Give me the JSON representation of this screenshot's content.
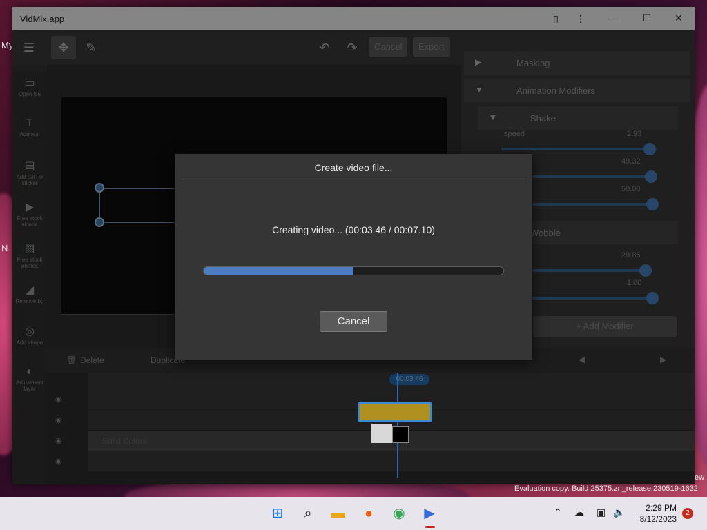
{
  "window": {
    "title": "VidMix.app"
  },
  "desktop": {
    "left_text_1": "My",
    "left_text_2": "N"
  },
  "toolbar": {
    "cancel_label": "Cancel",
    "export_label": "Export"
  },
  "sidebar": {
    "items": [
      {
        "label": "Open file",
        "icon": "folder-icon"
      },
      {
        "label": "Add text",
        "icon": "text-icon"
      },
      {
        "label": "Add GIF or sticker",
        "icon": "sticker-icon"
      },
      {
        "label": "Free stock videos",
        "icon": "video-icon"
      },
      {
        "label": "Free stock photos",
        "icon": "photo-icon"
      },
      {
        "label": "Remove bg",
        "icon": "eraser-icon"
      },
      {
        "label": "Add shape",
        "icon": "shape-icon"
      },
      {
        "label": "Adjustment layer",
        "icon": "layer-icon"
      }
    ]
  },
  "properties": {
    "masking_label": "Masking",
    "animation_modifiers_label": "Animation Modifiers",
    "shake_label": "Shake",
    "speed_label": "speed",
    "speed_value": "2.93",
    "value_2": "49.32",
    "value_3": "50.00",
    "wobble_label": "Wobble",
    "value_4": "29.85",
    "value_5": "1.00",
    "add_modifier_label": "+ Add Modifier"
  },
  "timeline": {
    "delete_label": "Delete",
    "duplicate_label": "Duplicate",
    "time_marker": "00:03.46",
    "track_label": "Solid Colour"
  },
  "dialog": {
    "title": "Create video file...",
    "status": "Creating video... (00:03.46 / 00:07.10)",
    "progress": 0.5,
    "cancel_label": "Cancel"
  },
  "watermark": "Evaluation copy. Build 25375.zn_release.230519-1632",
  "watermark_right": "ew",
  "taskbar": {
    "time": "2:29 PM",
    "date": "8/12/2023",
    "notifications": "2"
  },
  "colors": {
    "accent": "#4a7ec0",
    "dialog_bg": "#353535",
    "clip": "#b09020"
  }
}
